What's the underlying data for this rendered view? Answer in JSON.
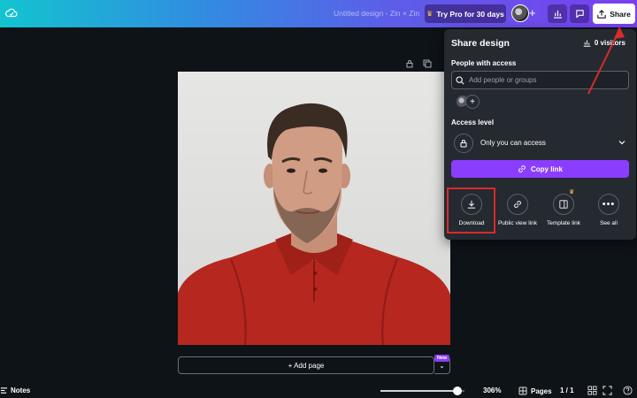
{
  "topbar": {
    "doc_title": "Untitled design - Zin × Zin",
    "try_pro_label": "Try Pro for 30 days",
    "share_label": "Share",
    "icons": [
      "cloud-icon",
      "crown-icon",
      "plus-icon",
      "chart-icon",
      "comment-icon",
      "share-upload-icon"
    ]
  },
  "canvas": {
    "photo_alt": "Photo of a man in a red polo shirt",
    "add_page_label": "+ Add page",
    "new_badge": "New"
  },
  "share_panel": {
    "title": "Share design",
    "visitors": "0 visitors",
    "people_label": "People with access",
    "people_placeholder": "Add people or groups",
    "access_label": "Access level",
    "access_value": "Only you can access",
    "copy_link_label": "Copy link",
    "actions": [
      {
        "label": "Download",
        "icon": "download-icon"
      },
      {
        "label": "Public view link",
        "icon": "link-icon"
      },
      {
        "label": "Template link",
        "icon": "template-icon"
      },
      {
        "label": "See all",
        "icon": "more-icon"
      }
    ]
  },
  "bottombar": {
    "notes_label": "Notes",
    "zoom_value": "306%",
    "zoom_slider_fraction": 0.92,
    "pages_label": "Pages",
    "page_count": "1 / 1"
  },
  "colors": {
    "accent": "#8b3dff",
    "highlight_box": "#d92b2b",
    "panel_bg": "#252a31",
    "app_bg": "#0e1318",
    "photo_shirt": "#b5271f"
  }
}
